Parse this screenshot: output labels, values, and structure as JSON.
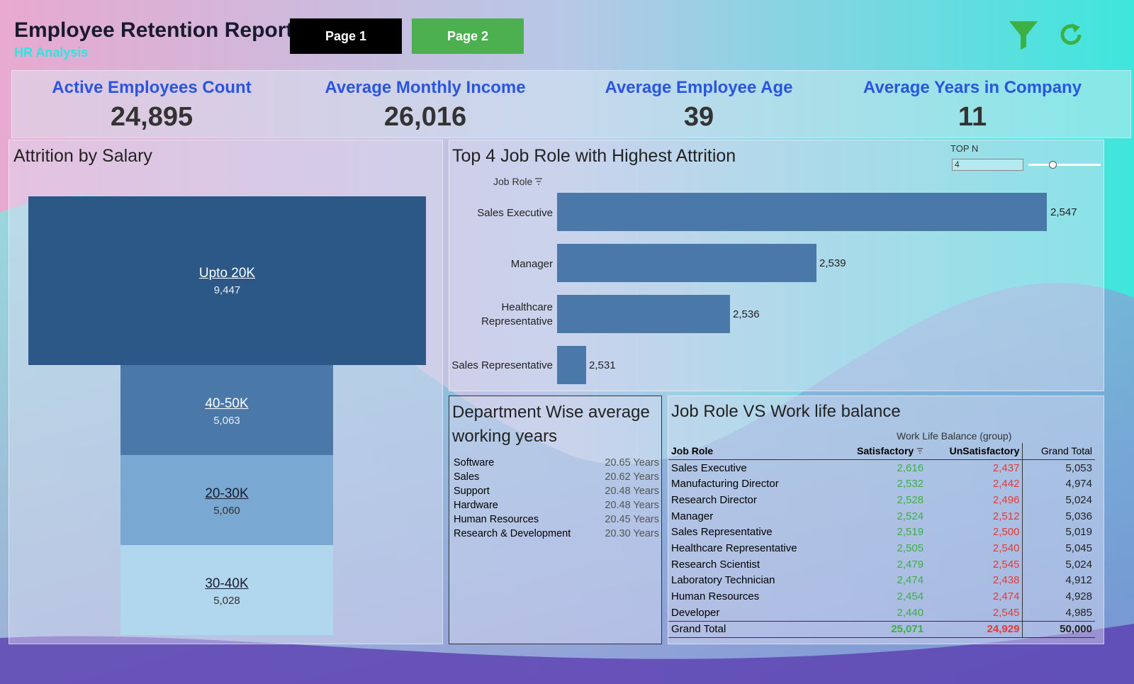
{
  "header": {
    "title": "Employee Retention Report",
    "subtitle": "HR Analysis",
    "page1": "Page 1",
    "page2": "Page 2"
  },
  "colors": {
    "page1_bg": "#000000",
    "page2_bg": "#4caf50",
    "kpi_label": "#2a55e0",
    "satisfactory": "#3cb043",
    "unsatisfactory": "#e53935",
    "funnel": [
      "#2b5886",
      "#4a78a8",
      "#79a9d2",
      "#b1d7ee"
    ],
    "bar": "#4a78a8"
  },
  "icons": {
    "filter": "filter-icon",
    "refresh": "refresh-icon"
  },
  "kpis": [
    {
      "label": "Active Employees Count",
      "value": "24,895"
    },
    {
      "label": "Average Monthly Income",
      "value": "26,016"
    },
    {
      "label": "Average Employee Age",
      "value": "39"
    },
    {
      "label": "Average Years in Company",
      "value": "11"
    }
  ],
  "attrition_salary": {
    "title": "Attrition by Salary",
    "items": [
      {
        "category": "Upto 20K",
        "value": "9,447"
      },
      {
        "category": "40-50K",
        "value": "5,063"
      },
      {
        "category": "20-30K",
        "value": "5,060"
      },
      {
        "category": "30-40K",
        "value": "5,028"
      }
    ]
  },
  "top_job_roles": {
    "title": "Top 4 Job Role with Highest Attrition",
    "topn_label": "TOP N",
    "topn_value": "4",
    "axis_label": "Job Role",
    "bars": [
      {
        "role": "Sales Executive",
        "value": "2,547"
      },
      {
        "role": "Manager",
        "value": "2,539"
      },
      {
        "role": "Healthcare Representative",
        "value": "2,536"
      },
      {
        "role": "Sales Representative",
        "value": "2,531"
      }
    ]
  },
  "dept_years": {
    "title": "Department Wise average working years",
    "rows": [
      {
        "dept": "Software",
        "years": "20.65 Years"
      },
      {
        "dept": "Sales",
        "years": "20.62 Years"
      },
      {
        "dept": "Support",
        "years": "20.48 Years"
      },
      {
        "dept": "Hardware",
        "years": "20.48 Years"
      },
      {
        "dept": "Human Resources",
        "years": "20.45 Years"
      },
      {
        "dept": "Research & Development",
        "years": "20.30 Years"
      }
    ]
  },
  "wlb": {
    "title": "Job Role VS Work life balance",
    "group_header": "Work Life Balance (group)",
    "col_role": "Job Role",
    "col_sat": "Satisfactory",
    "col_unsat": "UnSatisfactory",
    "col_total": "Grand Total",
    "rows": [
      {
        "role": "Sales Executive",
        "sat": "2,616",
        "unsat": "2,437",
        "total": "5,053"
      },
      {
        "role": "Manufacturing Director",
        "sat": "2,532",
        "unsat": "2,442",
        "total": "4,974"
      },
      {
        "role": "Research Director",
        "sat": "2,528",
        "unsat": "2,496",
        "total": "5,024"
      },
      {
        "role": "Manager",
        "sat": "2,524",
        "unsat": "2,512",
        "total": "5,036"
      },
      {
        "role": "Sales Representative",
        "sat": "2,519",
        "unsat": "2,500",
        "total": "5,019"
      },
      {
        "role": "Healthcare Representative",
        "sat": "2,505",
        "unsat": "2,540",
        "total": "5,045"
      },
      {
        "role": "Research Scientist",
        "sat": "2,479",
        "unsat": "2,545",
        "total": "5,024"
      },
      {
        "role": "Laboratory Technician",
        "sat": "2,474",
        "unsat": "2,438",
        "total": "4,912"
      },
      {
        "role": "Human Resources",
        "sat": "2,454",
        "unsat": "2,474",
        "total": "4,928"
      },
      {
        "role": "Developer",
        "sat": "2,440",
        "unsat": "2,545",
        "total": "4,985"
      }
    ],
    "grand": {
      "role": "Grand Total",
      "sat": "25,071",
      "unsat": "24,929",
      "total": "50,000"
    }
  }
}
